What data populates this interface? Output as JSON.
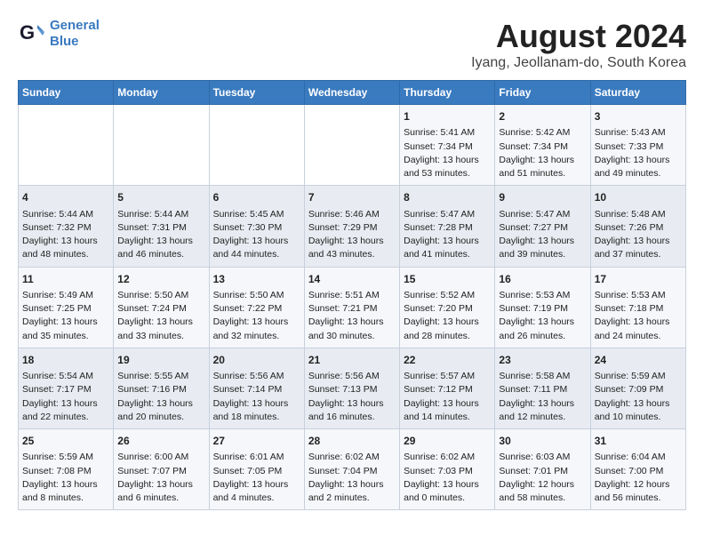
{
  "header": {
    "logo_line1": "General",
    "logo_line2": "Blue",
    "title": "August 2024",
    "subtitle": "Iyang, Jeollanam-do, South Korea"
  },
  "weekdays": [
    "Sunday",
    "Monday",
    "Tuesday",
    "Wednesday",
    "Thursday",
    "Friday",
    "Saturday"
  ],
  "weeks": [
    [
      {
        "day": "",
        "text": ""
      },
      {
        "day": "",
        "text": ""
      },
      {
        "day": "",
        "text": ""
      },
      {
        "day": "",
        "text": ""
      },
      {
        "day": "1",
        "text": "Sunrise: 5:41 AM\nSunset: 7:34 PM\nDaylight: 13 hours\nand 53 minutes."
      },
      {
        "day": "2",
        "text": "Sunrise: 5:42 AM\nSunset: 7:34 PM\nDaylight: 13 hours\nand 51 minutes."
      },
      {
        "day": "3",
        "text": "Sunrise: 5:43 AM\nSunset: 7:33 PM\nDaylight: 13 hours\nand 49 minutes."
      }
    ],
    [
      {
        "day": "4",
        "text": "Sunrise: 5:44 AM\nSunset: 7:32 PM\nDaylight: 13 hours\nand 48 minutes."
      },
      {
        "day": "5",
        "text": "Sunrise: 5:44 AM\nSunset: 7:31 PM\nDaylight: 13 hours\nand 46 minutes."
      },
      {
        "day": "6",
        "text": "Sunrise: 5:45 AM\nSunset: 7:30 PM\nDaylight: 13 hours\nand 44 minutes."
      },
      {
        "day": "7",
        "text": "Sunrise: 5:46 AM\nSunset: 7:29 PM\nDaylight: 13 hours\nand 43 minutes."
      },
      {
        "day": "8",
        "text": "Sunrise: 5:47 AM\nSunset: 7:28 PM\nDaylight: 13 hours\nand 41 minutes."
      },
      {
        "day": "9",
        "text": "Sunrise: 5:47 AM\nSunset: 7:27 PM\nDaylight: 13 hours\nand 39 minutes."
      },
      {
        "day": "10",
        "text": "Sunrise: 5:48 AM\nSunset: 7:26 PM\nDaylight: 13 hours\nand 37 minutes."
      }
    ],
    [
      {
        "day": "11",
        "text": "Sunrise: 5:49 AM\nSunset: 7:25 PM\nDaylight: 13 hours\nand 35 minutes."
      },
      {
        "day": "12",
        "text": "Sunrise: 5:50 AM\nSunset: 7:24 PM\nDaylight: 13 hours\nand 33 minutes."
      },
      {
        "day": "13",
        "text": "Sunrise: 5:50 AM\nSunset: 7:22 PM\nDaylight: 13 hours\nand 32 minutes."
      },
      {
        "day": "14",
        "text": "Sunrise: 5:51 AM\nSunset: 7:21 PM\nDaylight: 13 hours\nand 30 minutes."
      },
      {
        "day": "15",
        "text": "Sunrise: 5:52 AM\nSunset: 7:20 PM\nDaylight: 13 hours\nand 28 minutes."
      },
      {
        "day": "16",
        "text": "Sunrise: 5:53 AM\nSunset: 7:19 PM\nDaylight: 13 hours\nand 26 minutes."
      },
      {
        "day": "17",
        "text": "Sunrise: 5:53 AM\nSunset: 7:18 PM\nDaylight: 13 hours\nand 24 minutes."
      }
    ],
    [
      {
        "day": "18",
        "text": "Sunrise: 5:54 AM\nSunset: 7:17 PM\nDaylight: 13 hours\nand 22 minutes."
      },
      {
        "day": "19",
        "text": "Sunrise: 5:55 AM\nSunset: 7:16 PM\nDaylight: 13 hours\nand 20 minutes."
      },
      {
        "day": "20",
        "text": "Sunrise: 5:56 AM\nSunset: 7:14 PM\nDaylight: 13 hours\nand 18 minutes."
      },
      {
        "day": "21",
        "text": "Sunrise: 5:56 AM\nSunset: 7:13 PM\nDaylight: 13 hours\nand 16 minutes."
      },
      {
        "day": "22",
        "text": "Sunrise: 5:57 AM\nSunset: 7:12 PM\nDaylight: 13 hours\nand 14 minutes."
      },
      {
        "day": "23",
        "text": "Sunrise: 5:58 AM\nSunset: 7:11 PM\nDaylight: 13 hours\nand 12 minutes."
      },
      {
        "day": "24",
        "text": "Sunrise: 5:59 AM\nSunset: 7:09 PM\nDaylight: 13 hours\nand 10 minutes."
      }
    ],
    [
      {
        "day": "25",
        "text": "Sunrise: 5:59 AM\nSunset: 7:08 PM\nDaylight: 13 hours\nand 8 minutes."
      },
      {
        "day": "26",
        "text": "Sunrise: 6:00 AM\nSunset: 7:07 PM\nDaylight: 13 hours\nand 6 minutes."
      },
      {
        "day": "27",
        "text": "Sunrise: 6:01 AM\nSunset: 7:05 PM\nDaylight: 13 hours\nand 4 minutes."
      },
      {
        "day": "28",
        "text": "Sunrise: 6:02 AM\nSunset: 7:04 PM\nDaylight: 13 hours\nand 2 minutes."
      },
      {
        "day": "29",
        "text": "Sunrise: 6:02 AM\nSunset: 7:03 PM\nDaylight: 13 hours\nand 0 minutes."
      },
      {
        "day": "30",
        "text": "Sunrise: 6:03 AM\nSunset: 7:01 PM\nDaylight: 12 hours\nand 58 minutes."
      },
      {
        "day": "31",
        "text": "Sunrise: 6:04 AM\nSunset: 7:00 PM\nDaylight: 12 hours\nand 56 minutes."
      }
    ]
  ]
}
